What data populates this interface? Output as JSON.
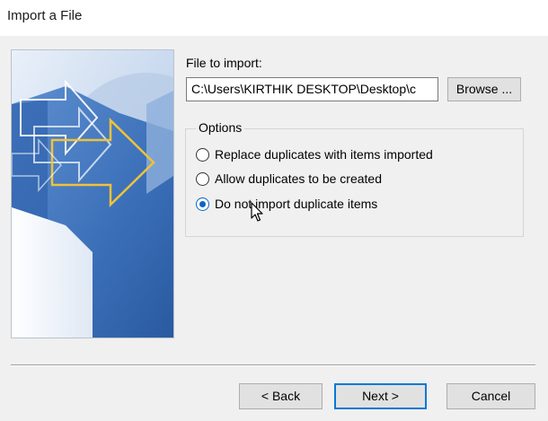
{
  "window": {
    "title": "Import a File"
  },
  "file": {
    "label": "File to import:",
    "value": "C:\\Users\\KIRTHIK DESKTOP\\Desktop\\c",
    "browse_label": "Browse ..."
  },
  "options": {
    "legend": "Options",
    "items": [
      {
        "label": "Replace duplicates with items imported",
        "checked": false
      },
      {
        "label": "Allow duplicates to be created",
        "checked": false
      },
      {
        "label": "Do not import duplicate items",
        "checked": true
      }
    ]
  },
  "buttons": {
    "back": "< Back",
    "next": "Next >",
    "cancel": "Cancel"
  },
  "colors": {
    "accent": "#0078d7",
    "radio_selected": "#0a64c8",
    "banner_blue": "#3a6fb8"
  }
}
